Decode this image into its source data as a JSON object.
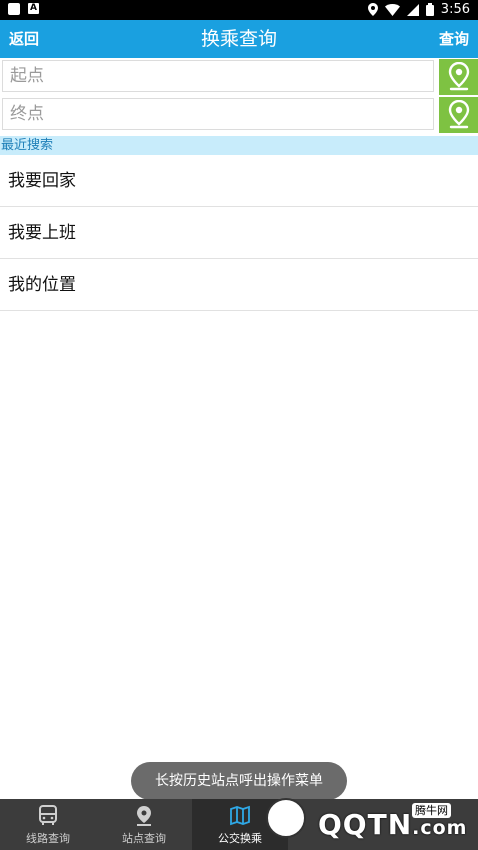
{
  "status_bar": {
    "time": "3:56",
    "notif_badge": "A"
  },
  "header": {
    "back_label": "返回",
    "title": "换乘查询",
    "query_label": "查询"
  },
  "start_field": {
    "placeholder": "起点",
    "value": ""
  },
  "end_field": {
    "placeholder": "终点",
    "value": ""
  },
  "recent": {
    "title": "最近搜索",
    "items": [
      {
        "label": "我要回家"
      },
      {
        "label": "我要上班"
      },
      {
        "label": "我的位置"
      }
    ]
  },
  "toast": {
    "text": "长按历史站点呼出操作菜单"
  },
  "tabs": [
    {
      "label": "线路查询",
      "icon": "bus-icon",
      "active": false
    },
    {
      "label": "站点查询",
      "icon": "location-pin-icon",
      "active": false
    },
    {
      "label": "公交换乘",
      "icon": "map-book-icon",
      "active": true
    }
  ],
  "watermark": {
    "brand": "QQTN",
    "suffix": ".com",
    "tag": "腾牛网"
  },
  "colors": {
    "header": "#1aa0e0",
    "pin_button": "#7ec242",
    "recent_bar": "#c8ecfb",
    "tabbar": "#3c3c3c"
  }
}
